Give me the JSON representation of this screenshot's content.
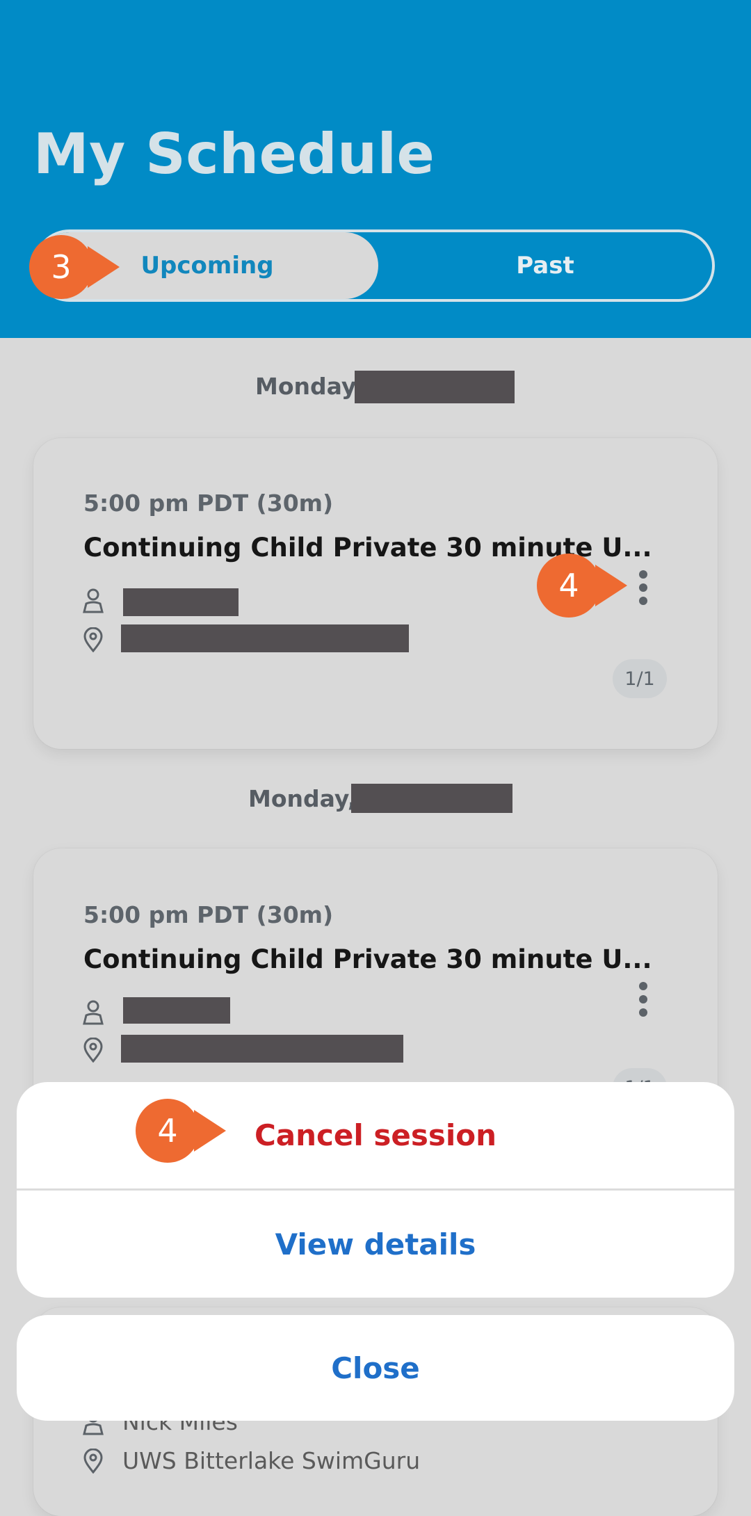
{
  "header": {
    "title": "My Schedule",
    "tabs": [
      "Upcoming",
      "Past"
    ],
    "active_tab": "Upcoming"
  },
  "markers": {
    "tab_marker": "3",
    "kebab_marker": "4",
    "cancel_marker": "4"
  },
  "sessions": [
    {
      "day": "Monday,",
      "time": "5:00 pm PDT (30m)",
      "title": "Continuing Child Private 30 minute U...",
      "count": "1/1"
    },
    {
      "day": "Monday,",
      "time": "5:00 pm PDT (30m)",
      "title": "Continuing Child Private 30 minute U...",
      "count": "1/1"
    },
    {
      "instructor": "Nick Miles",
      "location": "UWS Bitterlake SwimGuru"
    }
  ],
  "action_sheet": {
    "cancel_label": "Cancel session",
    "details_label": "View details",
    "close_label": "Close"
  },
  "colors": {
    "header": "#018bc6",
    "accent": "#1187bd",
    "marker": "#ee6a31",
    "danger": "#cc1f24",
    "link": "#1f6fc9"
  },
  "icons": [
    "person-icon",
    "location-pin-icon",
    "more-vertical-icon"
  ]
}
